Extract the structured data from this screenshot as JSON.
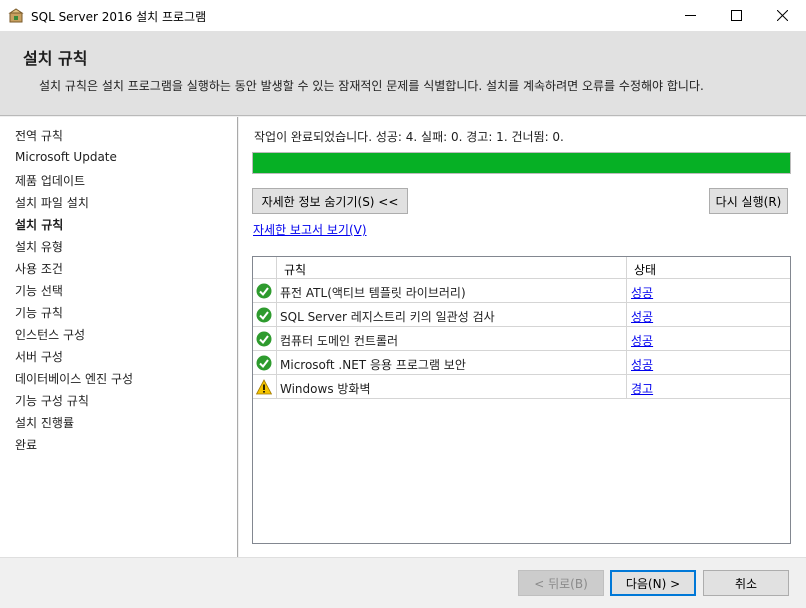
{
  "window": {
    "title": "SQL Server 2016 설치 프로그램"
  },
  "header": {
    "title": "설치 규칙",
    "description": "설치 규칙은 설치 프로그램을 실행하는 동안 발생할 수 있는 잠재적인 문제를 식별합니다. 설치를 계속하려면 오류를 수정해야 합니다."
  },
  "sidebar": {
    "items": [
      {
        "label": "전역 규칙"
      },
      {
        "label": "Microsoft Update"
      },
      {
        "label": "제품 업데이트"
      },
      {
        "label": "설치 파일 설치"
      },
      {
        "label": "설치 규칙"
      },
      {
        "label": "설치 유형"
      },
      {
        "label": "사용 조건"
      },
      {
        "label": "기능 선택"
      },
      {
        "label": "기능 규칙"
      },
      {
        "label": "인스턴스 구성"
      },
      {
        "label": "서버 구성"
      },
      {
        "label": "데이터베이스 엔진 구성"
      },
      {
        "label": "기능 구성 규칙"
      },
      {
        "label": "설치 진행률"
      },
      {
        "label": "완료"
      }
    ],
    "active_index": 4
  },
  "main": {
    "status_text": "작업이 완료되었습니다. 성공: 4. 실패: 0. 경고: 1. 건너뜀: 0.",
    "progress_fraction": 1.0,
    "hide_details_label": "자세한 정보 숨기기(S) <<",
    "rerun_label": "다시 실행(R)",
    "report_link": "자세한 보고서 보기(V)",
    "grid": {
      "header_rule": "규칙",
      "header_state": "상태",
      "rows": [
        {
          "icon": "check-circle-icon",
          "name": "퓨전 ATL(액티브 템플릿 라이브러리)",
          "state": "성공"
        },
        {
          "icon": "check-circle-icon",
          "name": "SQL Server 레지스트리 키의 일관성 검사",
          "state": "성공"
        },
        {
          "icon": "check-circle-icon",
          "name": "컴퓨터 도메인 컨트롤러",
          "state": "성공"
        },
        {
          "icon": "check-circle-icon",
          "name": "Microsoft .NET 응용 프로그램 보안",
          "state": "성공"
        },
        {
          "icon": "warning-icon",
          "name": "Windows 방화벽",
          "state": "경고"
        }
      ]
    }
  },
  "footer": {
    "back_label": "< 뒤로(B)",
    "next_label": "다음(N) >",
    "cancel_label": "취소"
  },
  "colors": {
    "progress": "#06b025",
    "link": "#0000ee",
    "success": "#2e9b2e",
    "warning": "#f5c400"
  }
}
